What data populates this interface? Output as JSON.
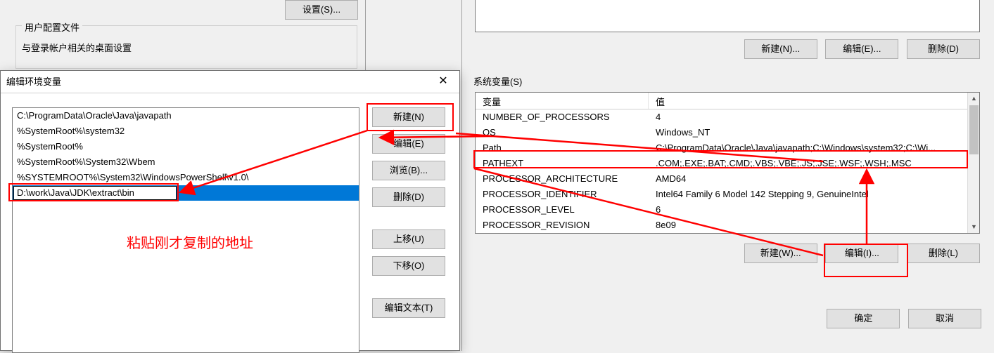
{
  "sysprops": {
    "settings_btn": "设置(S)...",
    "group_title": "用户配置文件",
    "group_desc": "与登录帐户相关的桌面设置"
  },
  "edit_dialog": {
    "title": "编辑环境变量",
    "items": [
      "C:\\ProgramData\\Oracle\\Java\\javapath",
      "%SystemRoot%\\system32",
      "%SystemRoot%",
      "%SystemRoot%\\System32\\Wbem",
      "%SYSTEMROOT%\\System32\\WindowsPowerShell\\v1.0\\"
    ],
    "editing_value": "D:\\work\\Java\\JDK\\extract\\bin",
    "buttons": {
      "new": "新建(N)",
      "edit": "编辑(E)",
      "browse": "浏览(B)...",
      "delete": "删除(D)",
      "move_up": "上移(U)",
      "move_down": "下移(O)",
      "edit_text": "编辑文本(T)"
    }
  },
  "env_dialog": {
    "upper_buttons": {
      "new": "新建(N)...",
      "edit": "编辑(E)...",
      "delete": "删除(D)"
    },
    "sysvar_label": "系统变量(S)",
    "col_var": "变量",
    "col_val": "值",
    "rows": [
      {
        "name": "NUMBER_OF_PROCESSORS",
        "value": "4"
      },
      {
        "name": "OS",
        "value": "Windows_NT"
      },
      {
        "name": "Path",
        "value": "C:\\ProgramData\\Oracle\\Java\\javapath;C:\\Windows\\system32;C:\\Wi..."
      },
      {
        "name": "PATHEXT",
        "value": ".COM;.EXE;.BAT;.CMD;.VBS;.VBE;.JS;.JSE;.WSF;.WSH;.MSC"
      },
      {
        "name": "PROCESSOR_ARCHITECTURE",
        "value": "AMD64"
      },
      {
        "name": "PROCESSOR_IDENTIFIER",
        "value": "Intel64 Family 6 Model 142 Stepping 9, GenuineIntel"
      },
      {
        "name": "PROCESSOR_LEVEL",
        "value": "6"
      },
      {
        "name": "PROCESSOR_REVISION",
        "value": "8e09"
      }
    ],
    "sys_buttons": {
      "new": "新建(W)...",
      "edit": "编辑(I)...",
      "delete": "删除(L)"
    },
    "footer": {
      "ok": "确定",
      "cancel": "取消"
    }
  },
  "annotation": {
    "paste_hint": "粘贴刚才复制的地址"
  }
}
